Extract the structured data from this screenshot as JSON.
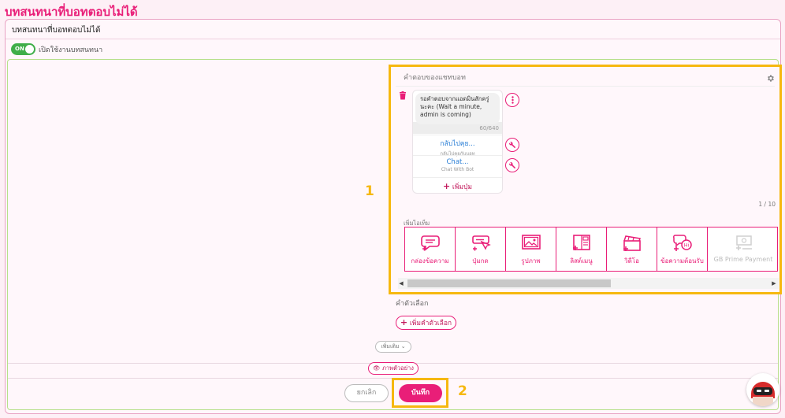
{
  "page": {
    "title": "บทสนทนาที่บอทตอบไม่ได้"
  },
  "card": {
    "title": "บทสนทนาที่บอทตอบไม่ได้",
    "toggle_state": "ON",
    "toggle_label": "เปิดใช้งานบทสนทนา"
  },
  "reply": {
    "header": "คำตอบของแชทบอท",
    "message_text": "รอคำตอบจากแอดมินสักครู่นะคะ (Wait a minute, admin is coming)",
    "char_count": "60/640",
    "buttons": [
      {
        "title": "กลับไปคุย...",
        "subtitle": "กลับไปคุยกับบอท"
      },
      {
        "title": "Chat...",
        "subtitle": "Chat With Bot"
      }
    ],
    "add_button_label": "เพิ่มปุ่ม",
    "page_count": "1 / 10",
    "add_item_label": "เพิ่มไอเท็ม",
    "items": [
      {
        "label": "กล่องข้อความ",
        "icon": "message-box-icon"
      },
      {
        "label": "ปุ่มกด",
        "icon": "button-icon"
      },
      {
        "label": "รูปภาพ",
        "icon": "image-icon"
      },
      {
        "label": "ลิสต์เมนู",
        "icon": "list-menu-icon"
      },
      {
        "label": "วิดีโอ",
        "icon": "video-icon"
      },
      {
        "label": "ข้อความต้อนรับ",
        "icon": "greeting-icon"
      },
      {
        "label": "GB Prime Payment",
        "icon": "payment-icon"
      }
    ]
  },
  "options": {
    "label": "คำตัวเลือก",
    "add_option_label": "เพิ่มคำตัวเลือก"
  },
  "more_label": "เพิ่มเติม",
  "preview_label": "ภาพตัวอย่าง",
  "cancel_label": "ยกเลิก",
  "save_label": "บันทึก",
  "annotations": {
    "one": "1",
    "two": "2"
  },
  "colors": {
    "brand": "#e91e78",
    "highlight": "#f6b80f",
    "toggle": "#3fae49",
    "link": "#2b7fd6"
  }
}
